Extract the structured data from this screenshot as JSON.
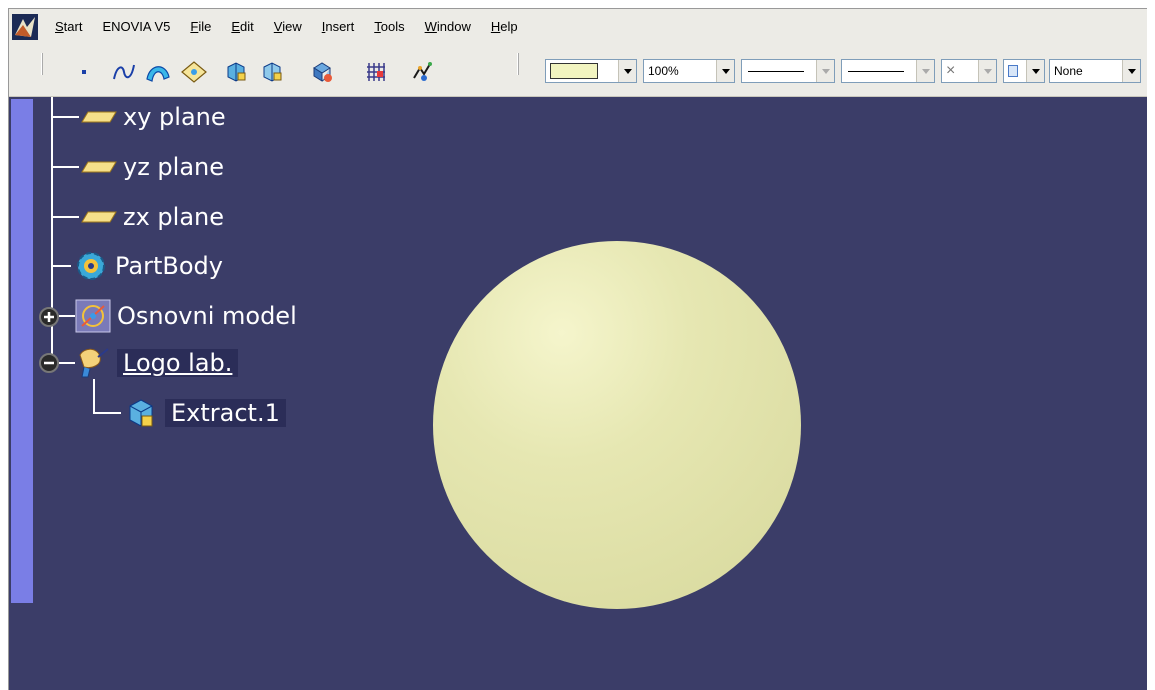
{
  "menu": {
    "start": "Start",
    "enovia": "ENOVIA V5",
    "file": "File",
    "edit": "Edit",
    "view": "View",
    "insert": "Insert",
    "tools": "Tools",
    "window": "Window",
    "help": "Help"
  },
  "toolbar": {
    "icons": [
      "point-icon",
      "spline-icon",
      "sweep-surface-icon",
      "fill-surface-icon",
      "extract-icon",
      "multiple-extract-icon",
      "transform-icon",
      "grid-icon",
      "law-icon"
    ],
    "color_combo": {
      "value": "",
      "swatch": "#f2f4c0"
    },
    "transparency_combo": {
      "value": "100%"
    },
    "line_thickness_combo": {
      "value": ""
    },
    "line_type_combo": {
      "value": ""
    },
    "point_symbol_combo": {
      "value": "×"
    },
    "layer_combo": {
      "value": "None"
    }
  },
  "tree": {
    "items": [
      {
        "label": "xy plane",
        "icon": "plane-icon"
      },
      {
        "label": "yz plane",
        "icon": "plane-icon"
      },
      {
        "label": "zx plane",
        "icon": "plane-icon"
      },
      {
        "label": "PartBody",
        "icon": "partbody-gear-icon"
      },
      {
        "label": "Osnovni model",
        "icon": "geometrical-set-icon",
        "expander": "+"
      },
      {
        "label": "Logo lab.",
        "icon": "geometrical-set-hand-icon",
        "expander": "−"
      },
      {
        "label": "Extract.1",
        "icon": "extract-cube-icon"
      }
    ]
  },
  "colors": {
    "background": "#3b3d68",
    "sphere": "#e3e5ad",
    "scroll_accent": "#7a7ee6",
    "toolbar_bg": "#ecebe6"
  }
}
